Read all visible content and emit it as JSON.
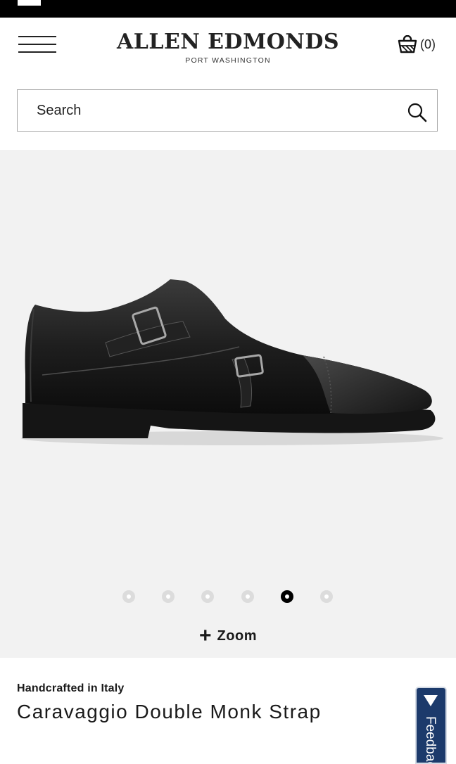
{
  "header": {
    "brand_name": "ALLEN EDMONDS",
    "brand_sub": "PORT WASHINGTON",
    "menu_icon": "hamburger-menu-icon",
    "cart_icon": "shopping-bag-icon",
    "cart_count": "(0)"
  },
  "search": {
    "placeholder": "Search",
    "icon": "search-icon"
  },
  "gallery": {
    "image_alt": "black double monk strap shoe",
    "dot_count": 6,
    "active_dot": 5,
    "zoom_icon": "plus-icon",
    "zoom_label": "Zoom"
  },
  "product": {
    "origin": "Handcrafted in Italy",
    "title": "Caravaggio Double Monk Strap"
  },
  "feedback": {
    "label": "Feedback",
    "icon": "triangle-down-icon"
  },
  "colors": {
    "status_bar": "#000000",
    "gallery_bg": "#f2f2f2",
    "feedback_bg": "#1c3a6b",
    "active_dot": "#000000",
    "inactive_dot": "#dcdcdc"
  }
}
